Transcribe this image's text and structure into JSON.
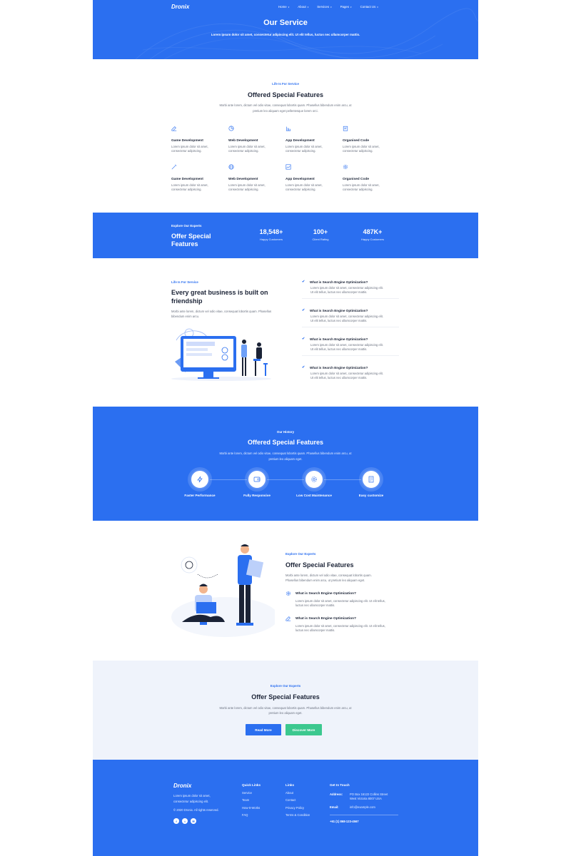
{
  "colors": {
    "primary": "#2b6ff0",
    "green": "#3cc88f",
    "light_bg": "#eff3fb",
    "dark_text": "#1b2336"
  },
  "header": {
    "logo": "Dronix",
    "nav": [
      {
        "label": "Home",
        "icon": "chevron-down-icon"
      },
      {
        "label": "About",
        "icon": "chevron-down-icon"
      },
      {
        "label": "Services",
        "icon": "chevron-down-icon"
      },
      {
        "label": "Pages",
        "icon": "chevron-down-icon"
      },
      {
        "label": "Contact Us",
        "icon": "chevron-down-icon"
      }
    ]
  },
  "hero": {
    "title": "Our Service",
    "subtitle": "Lorem ipsum dolor sit amet, consectetur adipiscing elit. Ut elit tellus, luctus nec ullamcorper mattis."
  },
  "features": {
    "eyebrow": "Life Is For Service",
    "title": "Offered Special Features",
    "desc1": "Morbi ante lorem, dictum vel odio vitae, consequat lobortis quam. Phasellus bibendum enim arcu, ut",
    "desc2": "pretium leo aliquam eget pellentesque lorem orci.",
    "items": [
      {
        "title": "Game Development",
        "text1": "Lorem ipsum dolor sit amet,",
        "text2": "consectetur adipiscing.",
        "icon": "edit-icon"
      },
      {
        "title": "Web Development",
        "text1": "Lorem ipsum dolor sit amet,",
        "text2": "consectetur adipiscing.",
        "icon": "pie-chart-icon"
      },
      {
        "title": "App Development",
        "text1": "Lorem ipsum dolor sit amet,",
        "text2": "consectetur adipiscing.",
        "icon": "bar-chart-icon"
      },
      {
        "title": "Organised Code",
        "text1": "Lorem ipsum dolor sit amet,",
        "text2": "consectetur adipiscing.",
        "icon": "clipboard-icon"
      },
      {
        "title": "Game Development",
        "text1": "Lorem ipsum dolor sit amet,",
        "text2": "consectetur adipiscing.",
        "icon": "magic-wand-icon"
      },
      {
        "title": "Web Development",
        "text1": "Lorem ipsum dolor sit amet,",
        "text2": "consectetur adipiscing.",
        "icon": "globe-icon"
      },
      {
        "title": "App Development",
        "text1": "Lorem ipsum dolor sit amet,",
        "text2": "consectetur adipiscing.",
        "icon": "line-chart-icon"
      },
      {
        "title": "Organised Code",
        "text1": "Lorem ipsum dolor sit amet,",
        "text2": "consectetur adipiscing.",
        "icon": "gear-icon"
      }
    ]
  },
  "stats": {
    "eyebrow": "Explore Our Experts",
    "title_line1": "Offer Special",
    "title_line2": "Features",
    "items": [
      {
        "value": "18,548+",
        "label": "Happy Customers"
      },
      {
        "value": "100+",
        "label": "Client Rating"
      },
      {
        "value": "487K+",
        "label": "Happy Customers"
      }
    ]
  },
  "about": {
    "eyebrow": "Life Is For Service",
    "title_line1": "Every great business is built on",
    "title_line2": "friendship",
    "desc1": "Morbi ante lorem, dictum vel odio vitae, consequat lobortis quam. Phasellus",
    "desc2": "bibendum enim arcu.",
    "faqs": [
      {
        "q": "What is Search Engine Optimization?",
        "a1": "Lorem ipsum dolor sit amet, consectetur adipiscing elit.",
        "a2": "Ut elit tellus, luctus nec ullamcorper mattis."
      },
      {
        "q": "What is Search Engine Optimization?",
        "a1": "Lorem ipsum dolor sit amet, consectetur adipiscing elit.",
        "a2": "Ut elit tellus, luctus nec ullamcorper mattis."
      },
      {
        "q": "What is Search Engine Optimization?",
        "a1": "Lorem ipsum dolor sit amet, consectetur adipiscing elit.",
        "a2": "Ut elit tellus, luctus nec ullamcorper mattis."
      },
      {
        "q": "What is Search Engine Optimization?",
        "a1": "Lorem ipsum dolor sit amet, consectetur adipiscing elit.",
        "a2": "Ut elit tellus, luctus nec ullamcorper mattis."
      }
    ]
  },
  "history": {
    "eyebrow": "Our History",
    "title": "Offered Special Features",
    "desc1": "Morbi ante lorem, dictum vel odio vitae, consequat lobortis quam. Phasellus bibendum enim arcu, ut",
    "desc2": "pretium leo aliquam eget.",
    "items": [
      {
        "label": "Faster Performance",
        "icon": "lightning-icon"
      },
      {
        "label": "Fully Responsive",
        "icon": "wallet-icon"
      },
      {
        "label": "Low Cost Maintenance",
        "icon": "gear-icon"
      },
      {
        "label": "Easy customize",
        "icon": "document-icon"
      }
    ]
  },
  "offer": {
    "eyebrow": "Explore Our Experts",
    "title": "Offer Special Features",
    "desc1": "Morbi ante lorem, dictum vel odio vitae, consequat lobortis quam.",
    "desc2": "Phasellus bibendum enim arcu, ut pretium leo aliquam eget.",
    "items": [
      {
        "q": "What is Search Engine Optimization?",
        "a1": "Lorem ipsum dolor sit amet, consectetur adipiscing elit. Ut elit tellus,",
        "a2": "luctus nec ullamcorper mattis.",
        "icon": "gear-icon"
      },
      {
        "q": "What is Search Engine Optimization?",
        "a1": "Lorem ipsum dolor sit amet, consectetur adipiscing elit. Ut elit tellus,",
        "a2": "luctus nec ullamcorper mattis.",
        "icon": "edit-icon"
      }
    ]
  },
  "cta": {
    "eyebrow": "Explore Our Experts",
    "title": "Offer Special Features",
    "desc1": "Morbi ante lorem, dictum vel odio vitae, consequat lobortis quam. Phasellus bibendum enim arcu, ut",
    "desc2": "pretium leo aliquam eget.",
    "read_more": "Read More",
    "discover_more": "Discover More"
  },
  "footer": {
    "logo": "Dronix",
    "about1": "Lorem ipsum dolor sit amet,",
    "about2": "consectetur adipiscing elit.",
    "copyright": "© 2020 Dronix. All rights reserved.",
    "quick_links_title": "Quick Links",
    "quick_links": [
      "Service",
      "Team",
      "How-It-Works",
      "FAQ"
    ],
    "links_title": "Links",
    "links": [
      "About",
      "Contact",
      "Privacy Policy",
      "Terms & Condition"
    ],
    "contact_title": "Get In Touch",
    "address_label": "Address:",
    "address1": "PO Box 16122 Collins Street",
    "address2": "West Victoria 8007 USA",
    "email_label": "Email:",
    "email": "info@example.com",
    "phone": "+61 (1) 868-123-4567"
  }
}
